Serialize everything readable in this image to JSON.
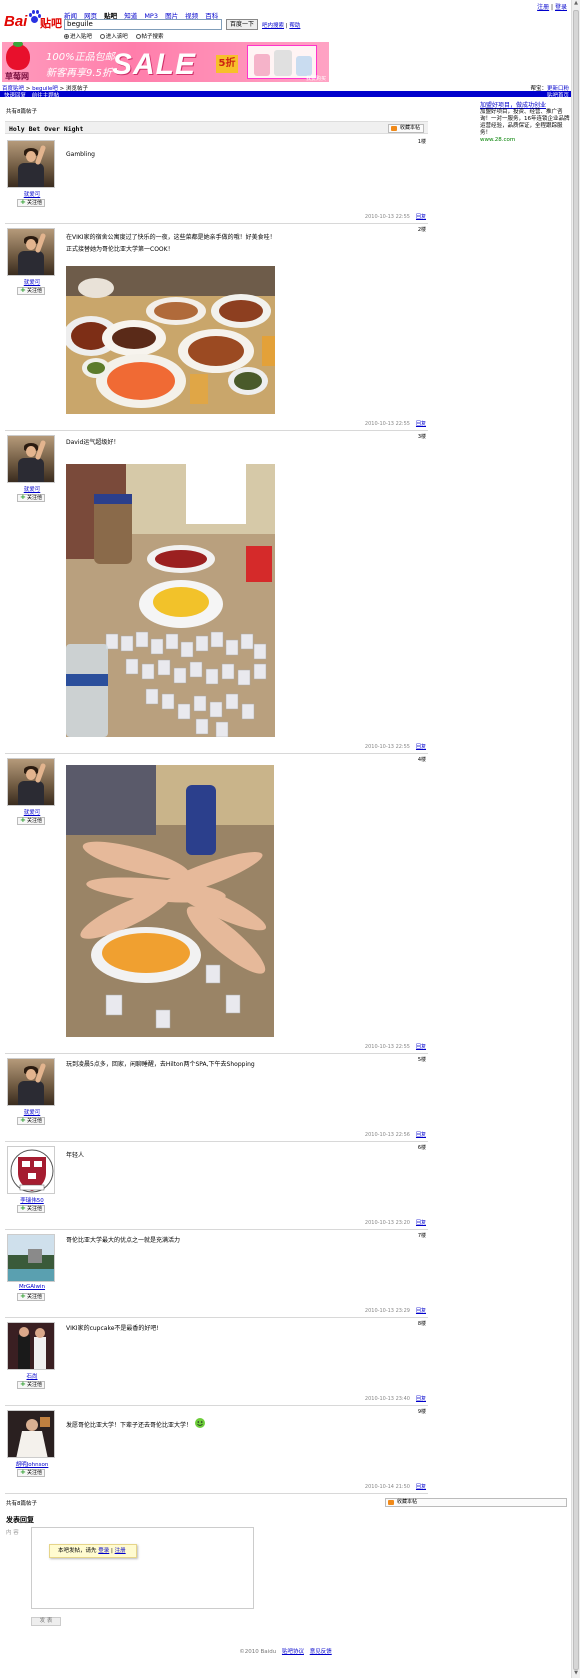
{
  "top_links": [
    "注册",
    "登录"
  ],
  "nav_tabs": [
    {
      "label": "新闻",
      "active": false
    },
    {
      "label": "网页",
      "active": false
    },
    {
      "label": "贴吧",
      "active": true
    },
    {
      "label": "知道",
      "active": false
    },
    {
      "label": "MP3",
      "active": false
    },
    {
      "label": "图片",
      "active": false
    },
    {
      "label": "视频",
      "active": false
    },
    {
      "label": "百科",
      "active": false
    }
  ],
  "logo": {
    "bai": "Bai",
    "tieba": "贴吧"
  },
  "search": {
    "value": "beguile",
    "button": "百度一下",
    "link_all": "吧内搜索",
    "link_help": "帮助"
  },
  "radios": [
    {
      "label": "进入贴吧",
      "checked": true
    },
    {
      "label": "进入该吧",
      "checked": false
    },
    {
      "label": "帖子搜索",
      "checked": false
    }
  ],
  "banner": {
    "line1": "100%正品包邮",
    "line2": "新客再享9.5折",
    "sale": "SALE",
    "discount": "5折",
    "brand": "草莓网",
    "more": "我要购买"
  },
  "breadcrumb": {
    "home": "百度贴吧",
    "forum": "beguile吧",
    "current": "浏览帖子",
    "right_prefix": "帮宝：",
    "right_link": "更新口粉"
  },
  "subbar": {
    "left1": "快速回复",
    "left2": "前往主题帖",
    "right": "贴吧首页"
  },
  "side_ad": {
    "title": "加盟好项目，做成功创业",
    "body": "加盟好项目，投资、经营、推广咨询！一对一服务，16年连锁企业品牌运营经验，品质保证，全程跟踪服务！",
    "url": "www.28.com"
  },
  "thread": {
    "page_info": "共有8篇帖子",
    "title": "Holy Bet Over Night",
    "fav_label": "收藏本帖",
    "bottom_info": "共有8篇帖子",
    "reply_title": "发表回复",
    "reply_label": "内 容",
    "login_tip": {
      "text": "本吧发帖，请先",
      "login": "登录",
      "sep": "|",
      "register": "注册"
    },
    "submit": "发 表",
    "footer": {
      "copyright": "©2010 Baidu",
      "terms": "贴吧协议",
      "feedback": "意见反馈"
    }
  },
  "posts": [
    {
      "floor": "1楼",
      "user": "就爱可",
      "follow": "关注他",
      "text": [
        "Gambling"
      ],
      "time": "2010-10-13 22:55",
      "reply": "回复"
    },
    {
      "floor": "2楼",
      "user": "就爱可",
      "follow": "关注他",
      "text": [
        "在VIKI家的宿舍公寓度过了快乐的一夜，这些菜都是她亲手做的哦！好美食哇！",
        "正式接替她为哥伦比亚大学第一COOK！"
      ],
      "time": "2010-10-13 22:55",
      "reply": "回复"
    },
    {
      "floor": "3楼",
      "user": "就爱可",
      "follow": "关注他",
      "text": [
        "David运气超级好！"
      ],
      "time": "2010-10-13 22:55",
      "reply": "回复"
    },
    {
      "floor": "4楼",
      "user": "就爱可",
      "follow": "关注他",
      "text": [],
      "time": "2010-10-13 22:55",
      "reply": "回复"
    },
    {
      "floor": "5楼",
      "user": "就爱可",
      "follow": "关注他",
      "text": [
        "玩到凌晨5点多，回家，闲聊睡醒，去Hilton两个SPA,下午去Shopping"
      ],
      "time": "2010-10-13 22:56",
      "reply": "回复"
    },
    {
      "floor": "6楼",
      "user": "李瑞伟50",
      "follow": "关注他",
      "text": [
        "年轻人"
      ],
      "time": "2010-10-13 23:20",
      "reply": "回复"
    },
    {
      "floor": "7楼",
      "user": "MrGAlwin",
      "follow": "关注他",
      "text": [
        "哥伦比亚大学最大的优点之一就是充满活力"
      ],
      "time": "2010-10-13 23:29",
      "reply": "回复"
    },
    {
      "floor": "8楼",
      "user": "石尚",
      "follow": "关注他",
      "text": [
        "VIKI家的cupcake不是最香的好吧!"
      ],
      "time": "2010-10-13 23:40",
      "reply": "回复"
    },
    {
      "floor": "9楼",
      "user": "胡明Johnson",
      "follow": "关注他",
      "text": [
        "发愿哥伦比亚大学！下辈子还去哥伦比亚大学！"
      ],
      "time": "2010-10-14 21:50",
      "reply": "回复"
    }
  ]
}
